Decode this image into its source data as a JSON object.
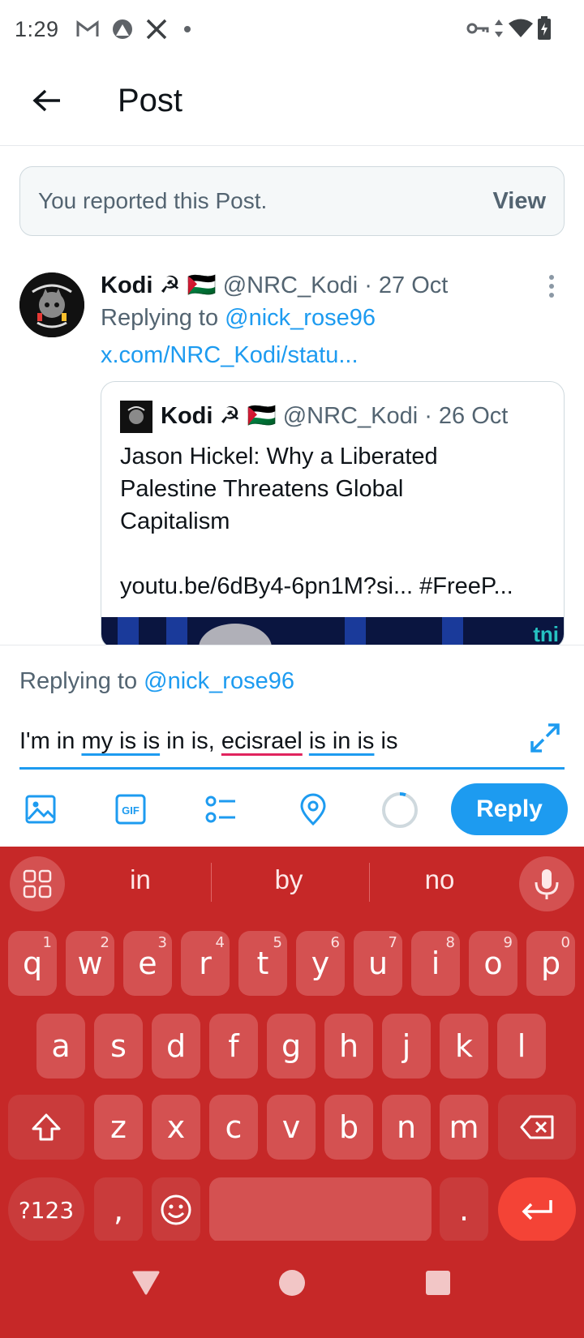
{
  "status_bar": {
    "time": "1:29",
    "left_icons": [
      "gmail-icon",
      "app-icon",
      "x-icon",
      "dot-icon"
    ],
    "right_icons": [
      "vpn-key-icon",
      "data-arrows-icon",
      "wifi-icon",
      "battery-charging-icon"
    ]
  },
  "header": {
    "title": "Post"
  },
  "banner": {
    "text": "You reported this Post.",
    "action": "View"
  },
  "tweet": {
    "name": "Kodi ☭ 🇵🇸",
    "meta": " @NRC_Kodi · 27 Oct",
    "reply_prefix": "Replying to ",
    "reply_handle": "@nick_rose96",
    "link": "x.com/NRC_Kodi/statu...",
    "quote": {
      "name": "Kodi ☭ 🇵🇸",
      "meta": " @NRC_Kodi · 26 Oct",
      "lines": [
        "Jason Hickel: Why a Liberated",
        "Palestine Threatens Global",
        "Capitalism",
        "",
        "youtu.be/6dBy4-6pn1M?si... #FreeP..."
      ],
      "media_logo": "tni"
    }
  },
  "compose": {
    "reply_prefix": "Replying to ",
    "reply_handle": "@nick_rose96",
    "text_parts": {
      "p1": "I'm in ",
      "p2": "my is is",
      "p3": " in is, ",
      "p4": "ecisrael",
      "p5": " ",
      "p6": "is in is",
      "p7": " is"
    },
    "reply_button": "Reply"
  },
  "keyboard": {
    "suggestions": [
      "in",
      "by",
      "no"
    ],
    "row1": [
      {
        "k": "q",
        "h": "1"
      },
      {
        "k": "w",
        "h": "2"
      },
      {
        "k": "e",
        "h": "3"
      },
      {
        "k": "r",
        "h": "4"
      },
      {
        "k": "t",
        "h": "5"
      },
      {
        "k": "y",
        "h": "6"
      },
      {
        "k": "u",
        "h": "7"
      },
      {
        "k": "i",
        "h": "8"
      },
      {
        "k": "o",
        "h": "9"
      },
      {
        "k": "p",
        "h": "0"
      }
    ],
    "row2": [
      "a",
      "s",
      "d",
      "f",
      "g",
      "h",
      "j",
      "k",
      "l"
    ],
    "row3": [
      "z",
      "x",
      "c",
      "v",
      "b",
      "n",
      "m"
    ],
    "symbols_label": "?123",
    "comma": ",",
    "period": "."
  },
  "colors": {
    "accent": "#1d9bf0",
    "keyboard_bg": "#c62828",
    "key_bg": "#d45151",
    "enter_bg": "#f44336"
  }
}
